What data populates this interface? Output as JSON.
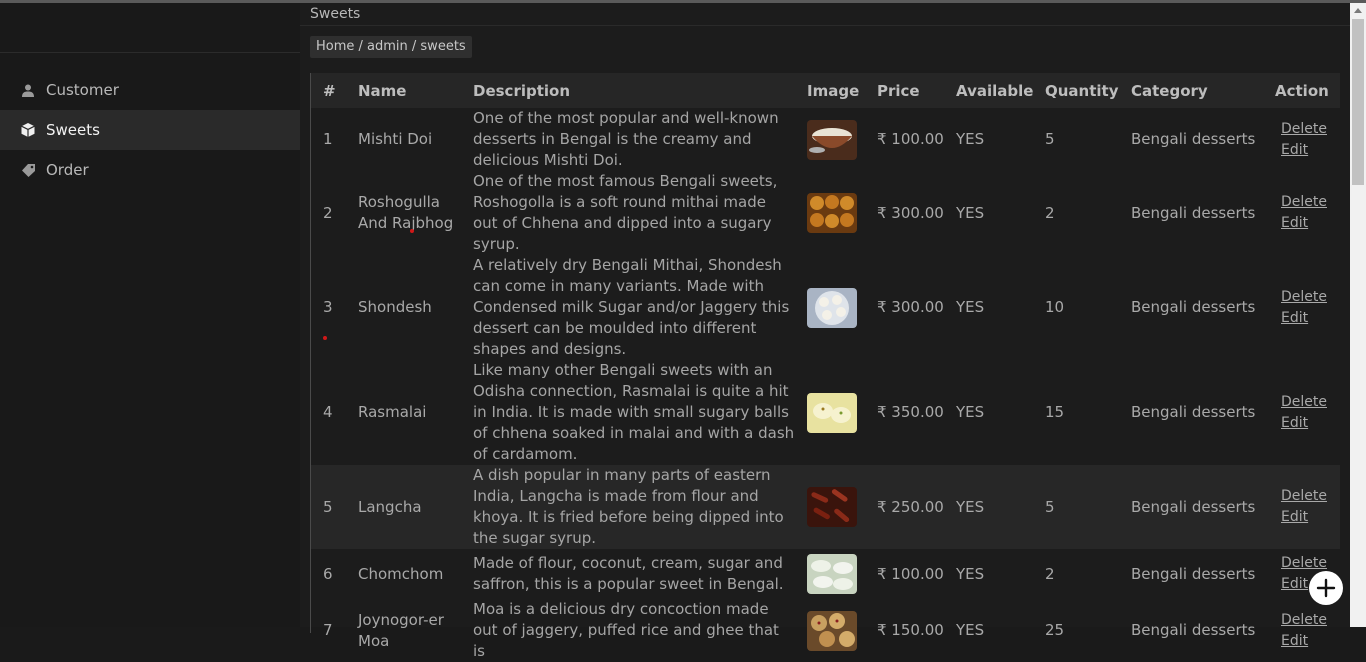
{
  "sidebar": {
    "items": [
      {
        "label": "Customer",
        "icon": "user-icon",
        "active": false
      },
      {
        "label": "Sweets",
        "icon": "cube-icon",
        "active": true
      },
      {
        "label": "Order",
        "icon": "tag-icon",
        "active": false
      }
    ]
  },
  "header": {
    "title": "Sweets"
  },
  "breadcrumb": {
    "text": "Home / admin / sweets"
  },
  "table": {
    "columns": [
      "#",
      "Name",
      "Description",
      "Image",
      "Price",
      "Available",
      "Quantity",
      "Category",
      "Action"
    ],
    "rows": [
      {
        "num": "1",
        "name": "Mishti Doi",
        "description": "One of the most popular and well-known desserts in Bengal is the creamy and delicious Mishti Doi.",
        "image": "mishti-doi-image",
        "price": "₹ 100.00",
        "available": "YES",
        "quantity": "5",
        "category": "Bengali desserts",
        "delete": "Delete",
        "edit": "Edit"
      },
      {
        "num": "2",
        "name": "Roshogulla And Rajbhog",
        "description": "One of the most famous Bengali sweets, Roshogolla is a soft round mithai made out of Chhena and dipped into a sugary syrup.",
        "image": "roshogulla-image",
        "price": "₹ 300.00",
        "available": "YES",
        "quantity": "2",
        "category": "Bengali desserts",
        "delete": "Delete",
        "edit": "Edit"
      },
      {
        "num": "3",
        "name": "Shondesh",
        "description": "A relatively dry Bengali Mithai, Shondesh can come in many variants. Made with Condensed milk Sugar and/or Jaggery this dessert can be moulded into different shapes and designs.",
        "image": "shondesh-image",
        "price": "₹ 300.00",
        "available": "YES",
        "quantity": "10",
        "category": "Bengali desserts",
        "delete": "Delete",
        "edit": "Edit"
      },
      {
        "num": "4",
        "name": "Rasmalai",
        "description": "Like many other Bengali sweets with an Odisha connection, Rasmalai is quite a hit in India. It is made with small sugary balls of chhena soaked in malai and with a dash of cardamom.",
        "image": "rasmalai-image",
        "price": "₹ 350.00",
        "available": "YES",
        "quantity": "15",
        "category": "Bengali desserts",
        "delete": "Delete",
        "edit": "Edit"
      },
      {
        "num": "5",
        "name": "Langcha",
        "description": "A dish popular in many parts of eastern India, Langcha is made from flour and khoya. It is fried before being dipped into the sugar syrup.",
        "image": "langcha-image",
        "price": "₹ 250.00",
        "available": "YES",
        "quantity": "5",
        "category": "Bengali desserts",
        "delete": "Delete",
        "edit": "Edit"
      },
      {
        "num": "6",
        "name": "Chomchom",
        "description": "Made of flour, coconut, cream, sugar and saffron, this is a popular sweet in Bengal.",
        "image": "chomchom-image",
        "price": "₹ 100.00",
        "available": "YES",
        "quantity": "2",
        "category": "Bengali desserts",
        "delete": "Delete",
        "edit": "Edit"
      },
      {
        "num": "7",
        "name": "Joynogor-er Moa",
        "description": "Moa is a delicious dry concoction made out of jaggery, puffed rice and ghee that is",
        "image": "moa-image",
        "price": "₹ 150.00",
        "available": "YES",
        "quantity": "25",
        "category": "Bengali desserts",
        "delete": "Delete",
        "edit": "Edit"
      }
    ]
  },
  "colors": {
    "background": "#1a1a1a",
    "sidebar_active": "#2a2a2a",
    "table_header": "#262626",
    "text": "#a9a9a9",
    "fab": "#ffffff"
  }
}
